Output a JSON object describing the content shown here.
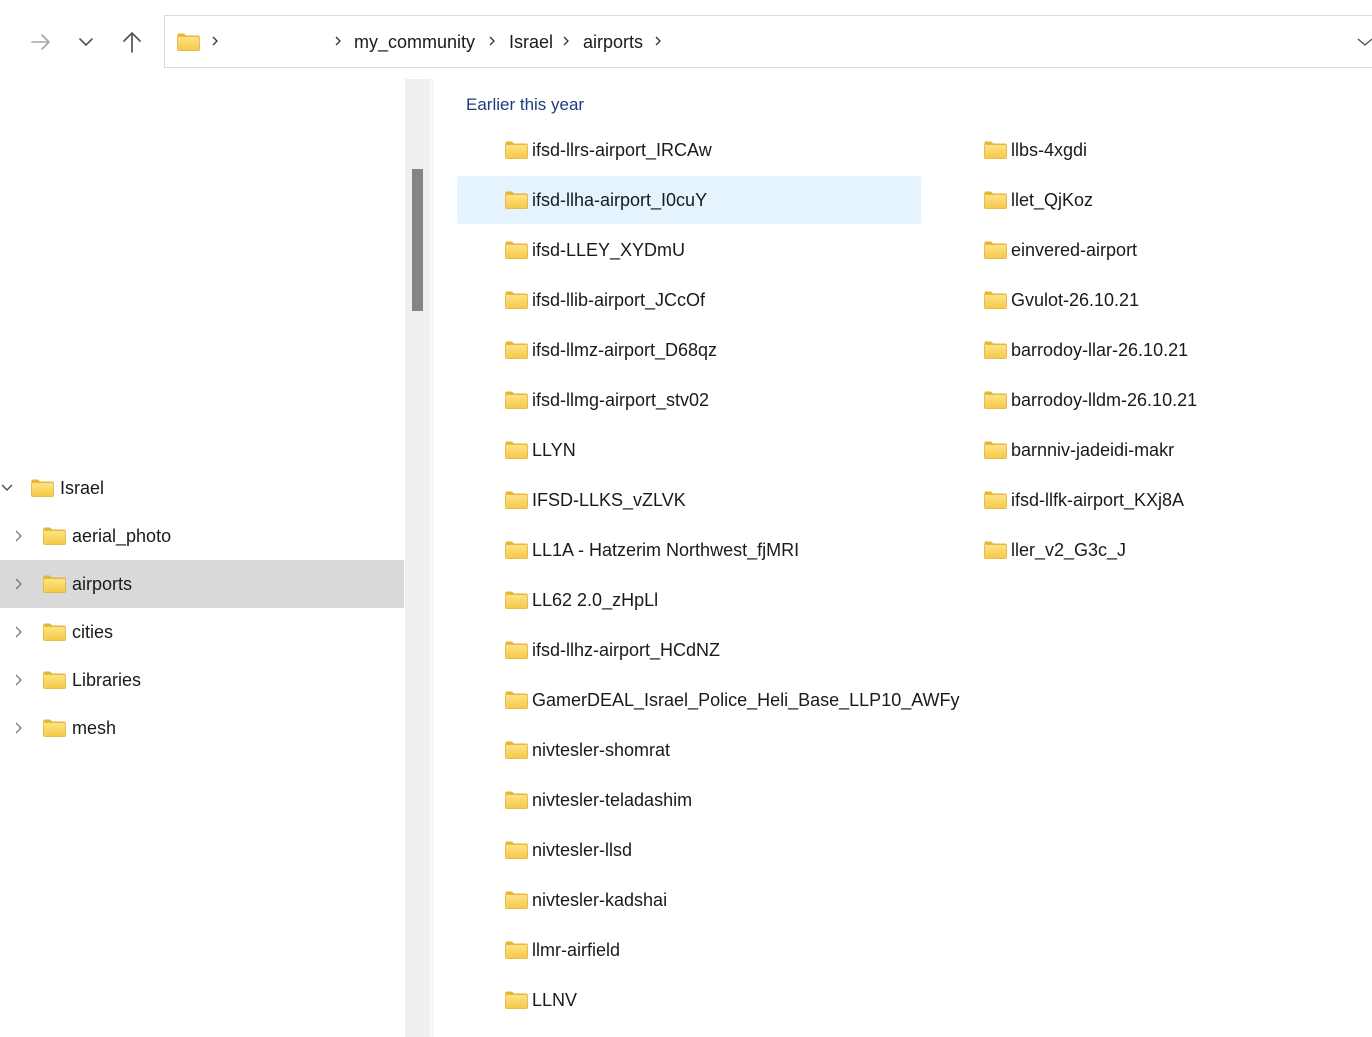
{
  "toolbar": {
    "forward_icon": "arrow-right-icon",
    "recent_icon": "chevron-down-icon",
    "up_icon": "arrow-up-icon"
  },
  "address_bar": {
    "root_icon": "folder-icon",
    "breadcrumbs": [
      {
        "label": ""
      },
      {
        "label": "my_community"
      },
      {
        "label": "Israel"
      },
      {
        "label": "airports"
      }
    ],
    "dropdown_icon": "chevron-down-icon"
  },
  "nav_pane": {
    "items": [
      {
        "label": "Israel",
        "expanded": true,
        "selected": false,
        "level": 0
      },
      {
        "label": "aerial_photo",
        "expanded": false,
        "selected": false,
        "level": 1
      },
      {
        "label": "airports",
        "expanded": false,
        "selected": true,
        "level": 1
      },
      {
        "label": "cities",
        "expanded": false,
        "selected": false,
        "level": 1
      },
      {
        "label": "Libraries",
        "expanded": false,
        "selected": false,
        "level": 1
      },
      {
        "label": "mesh",
        "expanded": false,
        "selected": false,
        "level": 1
      }
    ]
  },
  "content": {
    "group_header": "Earlier this year",
    "selected_index": 1,
    "column_1": [
      "ifsd-llrs-airport_IRCAw",
      "ifsd-llha-airport_I0cuY",
      "ifsd-LLEY_XYDmU",
      "ifsd-llib-airport_JCcOf",
      "ifsd-llmz-airport_D68qz",
      "ifsd-llmg-airport_stv02",
      "LLYN",
      "IFSD-LLKS_vZLVK",
      "LL1A - Hatzerim Northwest_fjMRI",
      "LL62 2.0_zHpLl",
      "ifsd-llhz-airport_HCdNZ",
      "GamerDEAL_Israel_Police_Heli_Base_LLP10_AWFy",
      "nivtesler-shomrat",
      "nivtesler-teladashim",
      "nivtesler-llsd",
      "nivtesler-kadshai",
      "llmr-airfield",
      "LLNV"
    ],
    "column_2": [
      "llbs-4xgdi",
      "llet_QjKoz",
      "einvered-airport",
      "Gvulot-26.10.21",
      "barrodoy-llar-26.10.21",
      "barrodoy-lldm-26.10.21",
      "barnniv-jadeidi-makr",
      "ifsd-llfk-airport_KXj8A",
      "ller_v2_G3c_J"
    ]
  },
  "colors": {
    "folder_yellow": "#f8d775",
    "folder_dark": "#e8b530",
    "selection_bg": "#e5f3ff",
    "nav_selection_bg": "#d9d9d9",
    "group_header": "#1f3d7a"
  }
}
